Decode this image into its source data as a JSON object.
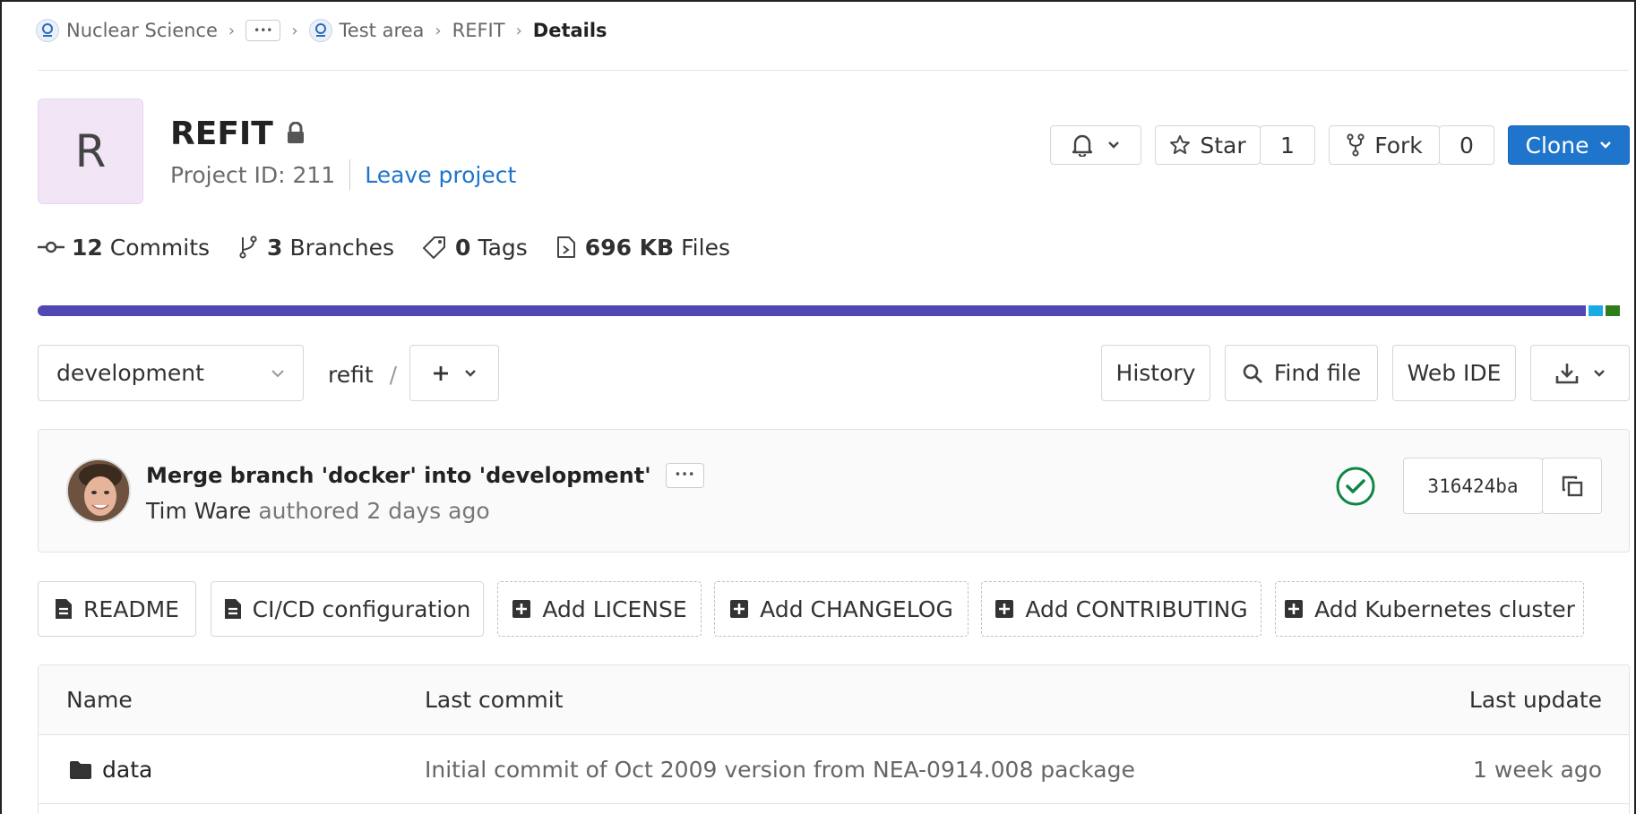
{
  "breadcrumb": {
    "group": "Nuclear Science",
    "ellipsis": "•••",
    "subgroup": "Test area",
    "project": "REFIT",
    "current": "Details"
  },
  "project": {
    "avatar_letter": "R",
    "name": "REFIT",
    "id_label": "Project ID: 211",
    "leave_label": "Leave project"
  },
  "actions": {
    "star_label": "Star",
    "star_count": "1",
    "fork_label": "Fork",
    "fork_count": "0",
    "clone_label": "Clone"
  },
  "stats": {
    "commits_count": "12",
    "commits_label": "Commits",
    "branches_count": "3",
    "branches_label": "Branches",
    "tags_count": "0",
    "tags_label": "Tags",
    "files_size": "696 KB",
    "files_label": "Files"
  },
  "language_bar": {
    "colors": [
      "#5046b4",
      "#1aaae5",
      "#2e7d1a"
    ],
    "fractions": [
      0.976,
      0.009,
      0.009
    ]
  },
  "repo_toolbar": {
    "branch": "development",
    "path": "refit",
    "path_sep": "/",
    "history_label": "History",
    "find_file_label": "Find file",
    "web_ide_label": "Web IDE"
  },
  "last_commit": {
    "title": "Merge branch 'docker' into 'development'",
    "ellipsis": "•••",
    "author": "Tim Ware",
    "meta": "authored 2 days ago",
    "sha": "316424ba"
  },
  "shortcuts": {
    "readme": "README",
    "cicd": "CI/CD configuration",
    "license": "Add LICENSE",
    "changelog": "Add CHANGELOG",
    "contributing": "Add CONTRIBUTING",
    "kubernetes": "Add Kubernetes cluster"
  },
  "file_table": {
    "headers": {
      "name": "Name",
      "last_commit": "Last commit",
      "last_update": "Last update"
    },
    "rows": [
      {
        "name": "data",
        "commit": "Initial commit of Oct 2009 version from NEA-0914.008 package",
        "updated": "1 week ago"
      }
    ]
  },
  "colors": {
    "link": "#1f75cb",
    "primary": "#1f75cb",
    "success": "#108548",
    "avatar_bg": "#f1e5f6"
  }
}
